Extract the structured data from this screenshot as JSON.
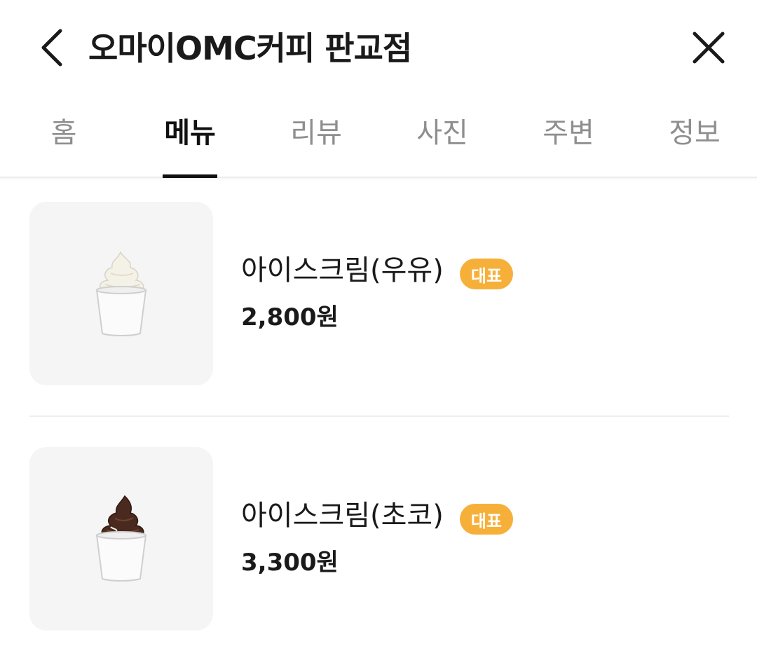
{
  "header": {
    "title": "오마이OMC커피 판교점",
    "back_icon": "chevron-left-icon",
    "close_icon": "close-icon"
  },
  "tabs": [
    {
      "label": "홈",
      "active": false
    },
    {
      "label": "메뉴",
      "active": true
    },
    {
      "label": "리뷰",
      "active": false
    },
    {
      "label": "사진",
      "active": false
    },
    {
      "label": "주변",
      "active": false
    },
    {
      "label": "정보",
      "active": false
    }
  ],
  "menu": {
    "items": [
      {
        "name": "아이스크림(우유)",
        "badge": "대표",
        "price": "2,800원",
        "image": "vanilla-soft-serve-cup"
      },
      {
        "name": "아이스크림(초코)",
        "badge": "대표",
        "price": "3,300원",
        "image": "chocolate-soft-serve-cup"
      }
    ]
  },
  "colors": {
    "badge": "#f6b03a",
    "active_tab": "#111111",
    "inactive_tab": "#8e8e8e",
    "thumb_bg": "#f5f5f5"
  }
}
